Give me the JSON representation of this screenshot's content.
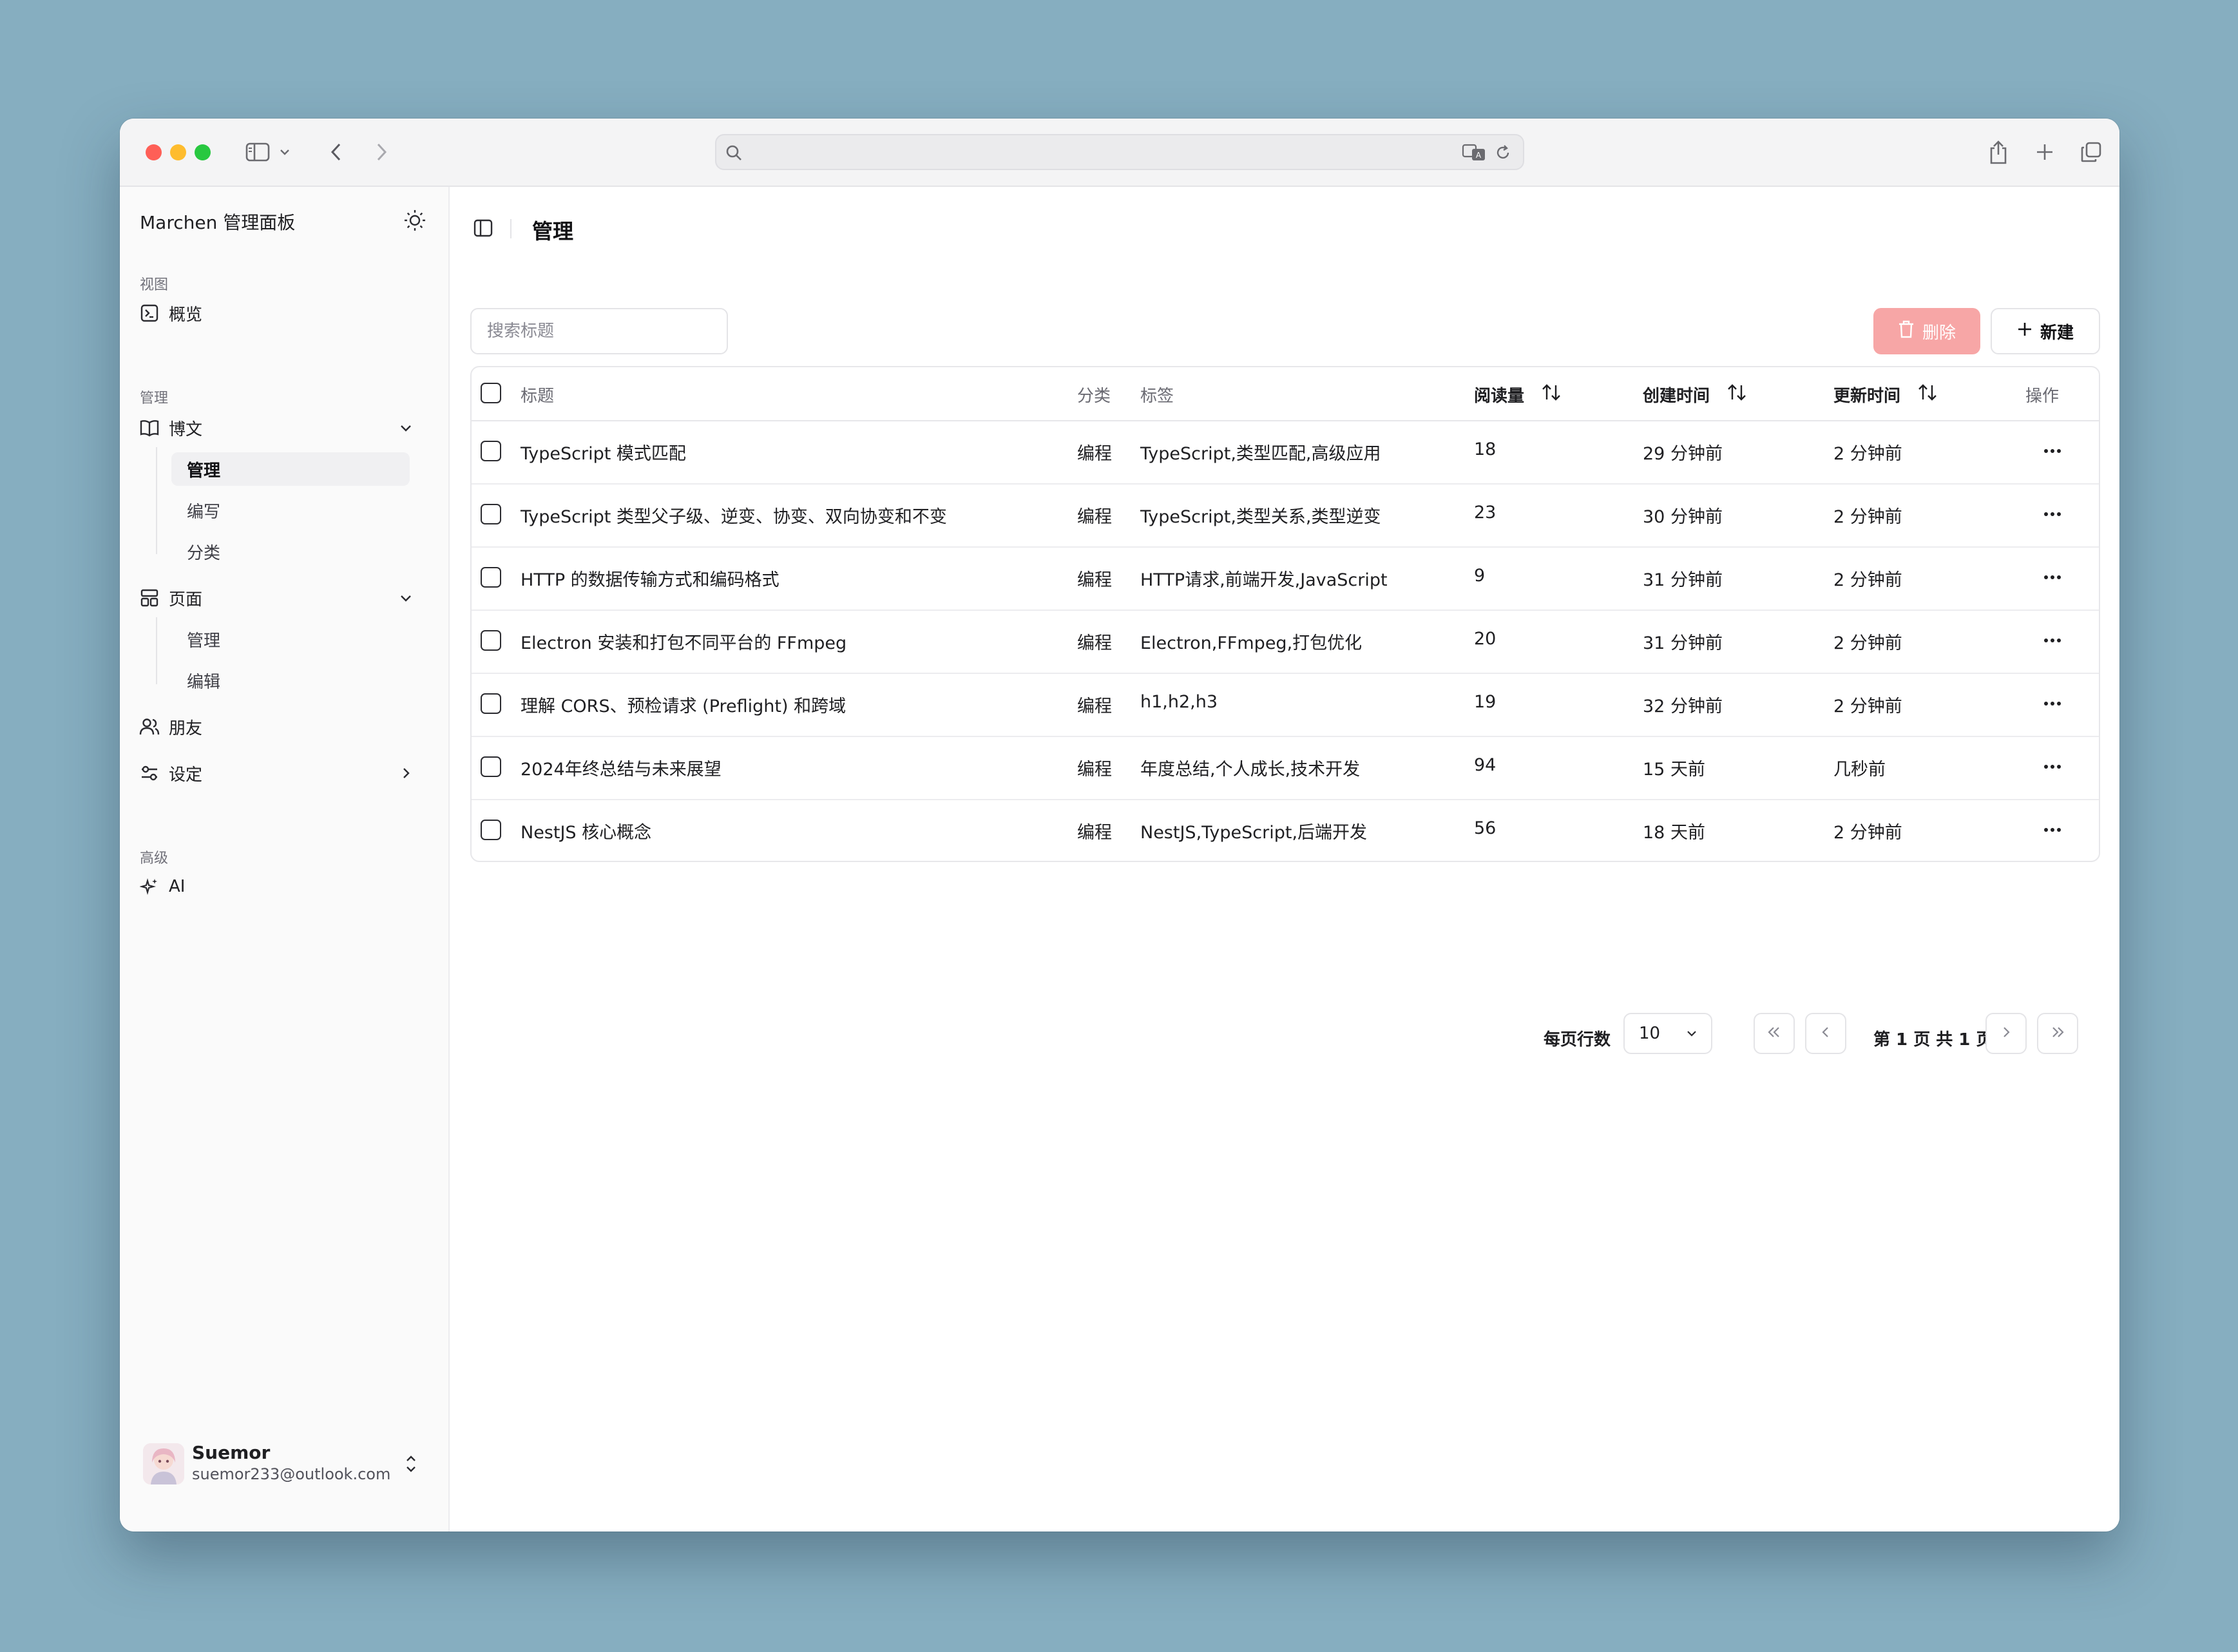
{
  "browser": {
    "url": ""
  },
  "sidebar": {
    "title": "Marchen 管理面板",
    "sections": {
      "view": "视图",
      "manage": "管理",
      "advanced": "高级"
    },
    "items": {
      "overview": "概览",
      "posts": "博文",
      "posts_manage": "管理",
      "posts_write": "编写",
      "posts_category": "分类",
      "pages": "页面",
      "pages_manage": "管理",
      "pages_edit": "编辑",
      "friends": "朋友",
      "settings": "设定",
      "ai": "AI"
    },
    "user": {
      "name": "Suemor",
      "email": "suemor233@outlook.com"
    }
  },
  "main": {
    "title": "管理",
    "search_placeholder": "搜索标题",
    "delete_label": "删除",
    "new_label": "新建",
    "columns": {
      "title": "标题",
      "category": "分类",
      "tags": "标签",
      "reads": "阅读量",
      "created": "创建时间",
      "updated": "更新时间",
      "actions": "操作"
    },
    "rows": [
      {
        "title": "TypeScript 模式匹配",
        "category": "编程",
        "tags": "TypeScript,类型匹配,高级应用",
        "reads": "18",
        "created": "29 分钟前",
        "updated": "2 分钟前"
      },
      {
        "title": "TypeScript 类型父子级、逆变、协变、双向协变和不变",
        "category": "编程",
        "tags": "TypeScript,类型关系,类型逆变",
        "reads": "23",
        "created": "30 分钟前",
        "updated": "2 分钟前"
      },
      {
        "title": "HTTP 的数据传输方式和编码格式",
        "category": "编程",
        "tags": "HTTP请求,前端开发,JavaScript",
        "reads": "9",
        "created": "31 分钟前",
        "updated": "2 分钟前"
      },
      {
        "title": "Electron 安装和打包不同平台的 FFmpeg",
        "category": "编程",
        "tags": "Electron,FFmpeg,打包优化",
        "reads": "20",
        "created": "31 分钟前",
        "updated": "2 分钟前"
      },
      {
        "title": "理解 CORS、预检请求 (Preflight) 和跨域",
        "category": "编程",
        "tags": "h1,h2,h3",
        "reads": "19",
        "created": "32 分钟前",
        "updated": "2 分钟前"
      },
      {
        "title": "2024年终总结与未来展望",
        "category": "编程",
        "tags": "年度总结,个人成长,技术开发",
        "reads": "94",
        "created": "15 天前",
        "updated": "几秒前"
      },
      {
        "title": "NestJS 核心概念",
        "category": "编程",
        "tags": "NestJS,TypeScript,后端开发",
        "reads": "56",
        "created": "18 天前",
        "updated": "2 分钟前"
      }
    ],
    "pagination": {
      "rows_per_page_label": "每页行数",
      "rows_per_page": "10",
      "page_info": "第 1 页 共 1 页"
    }
  },
  "colors": {
    "delete_bg": "#f7a6a6",
    "background": "#86aec0"
  },
  "icons": [
    "sidebar-icon",
    "chevron-left-icon",
    "chevron-right-icon",
    "search-icon",
    "translate-icon",
    "reload-icon",
    "share-icon",
    "plus-icon",
    "tabs-icon",
    "sun-icon",
    "terminal-icon",
    "book-icon",
    "layout-icon",
    "users-icon",
    "settings-icon",
    "sparkles-icon",
    "trash-icon",
    "sort-icon",
    "more-icon",
    "chevrons-up-down-icon"
  ]
}
